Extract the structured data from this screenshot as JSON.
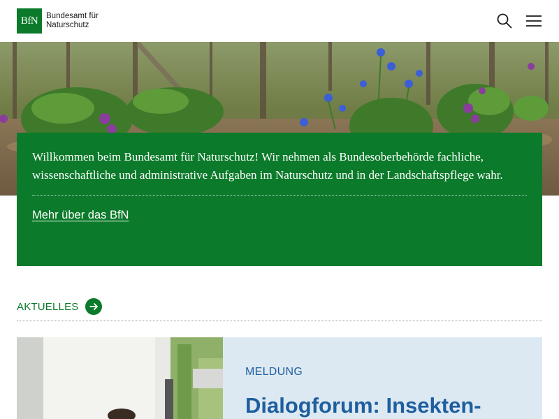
{
  "header": {
    "logo_mark": "BfN",
    "logo_line1": "Bundesamt für",
    "logo_line2": "Naturschutz",
    "search_icon": "search-icon",
    "menu_icon": "hamburger-menu-icon"
  },
  "hero": {
    "intro_text": "Willkommen beim Bundesamt für Naturschutz! Wir nehmen als Bundesoberbehörde fachliche, wissenschaftliche und administrative Aufgaben im Naturschutz und in der Landschaftspflege wahr.",
    "link_label": "Mehr über das BfN"
  },
  "news": {
    "section_label": "AKTUELLES",
    "arrow_icon": "arrow-right-icon",
    "card": {
      "kicker": "MELDUNG",
      "title": "Dialogforum: Insekten-"
    }
  },
  "colors": {
    "brand_green": "#0b7a2a",
    "card_background": "#dde9f2",
    "card_text_blue": "#1e5e9f"
  }
}
